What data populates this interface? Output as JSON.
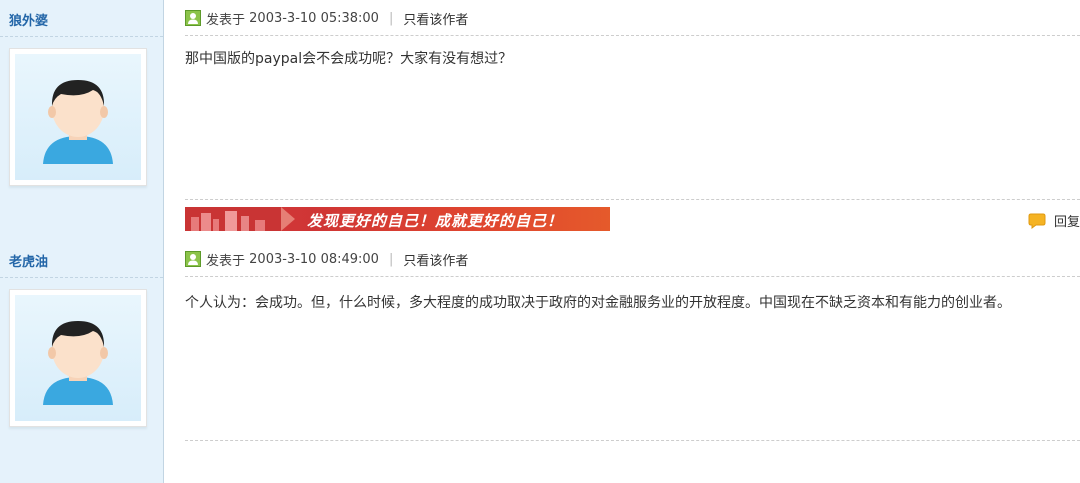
{
  "posts": [
    {
      "author": "狼外婆",
      "posted_prefix": "发表于",
      "posted_time": "2003-3-10 05:38:00",
      "view_author_only": "只看该作者",
      "content": "那中国版的paypal会不会成功呢？大家有没有想过？",
      "banner_text": "发现更好的自己！成就更好的自己！",
      "reply_label": "回复"
    },
    {
      "author": "老虎油",
      "posted_prefix": "发表于",
      "posted_time": "2003-3-10 08:49:00",
      "view_author_only": "只看该作者",
      "content": "个人认为：会成功。但，什么时候，多大程度的成功取决于政府的对金融服务业的开放程度。中国现在不缺乏资本和有能力的创业者。"
    }
  ],
  "colors": {
    "author_link": "#2366a8",
    "sidebar_bg": "#e5f2fb",
    "banner": "#d83a3a"
  },
  "icons": {
    "online_status": "user-online-icon",
    "reply": "reply-bubble-icon",
    "avatar": "default-avatar-icon"
  }
}
